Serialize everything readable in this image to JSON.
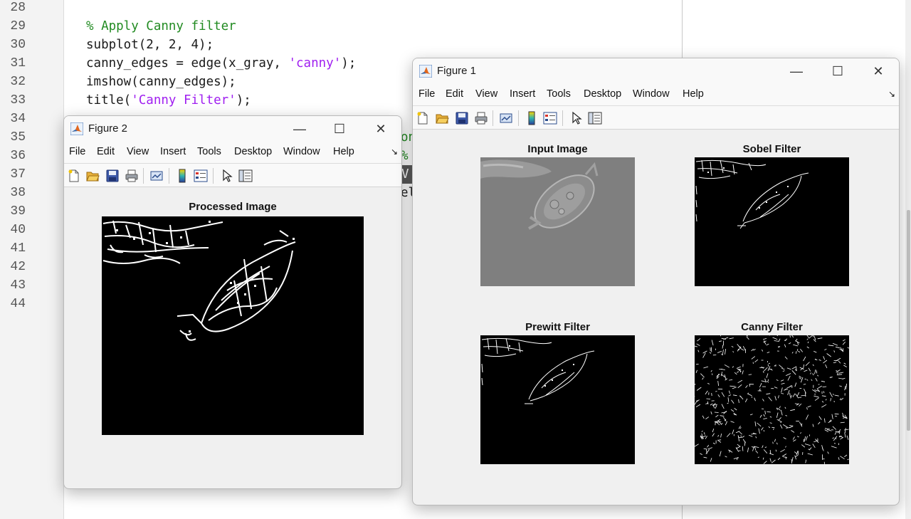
{
  "editor": {
    "line_numbers": [
      "28",
      "29",
      "30",
      "31",
      "32",
      "33",
      "34",
      "35",
      "36",
      "37",
      "38",
      "39",
      "40",
      "41",
      "42",
      "43",
      "44"
    ],
    "code": {
      "l29": "% Apply Canny filter",
      "l30": "subplot(2, 2, 4);",
      "l31a": "canny_edges = edge(x_gray, ",
      "l31b": "'canny'",
      "l31c": ");",
      "l32": "imshow(canny_edges);",
      "l33a": "title(",
      "l33b": "'Canny Filter'",
      "l33c": ");"
    },
    "peek": {
      "l35": "on",
      "l36": "%",
      "l37": "V",
      "l38": "el"
    },
    "colors": {
      "comment": "#228b22",
      "string": "#a020f0"
    }
  },
  "menus": [
    "File",
    "Edit",
    "View",
    "Insert",
    "Tools",
    "Desktop",
    "Window",
    "Help"
  ],
  "figure2": {
    "title": "Figure 2",
    "axes_title": "Processed Image"
  },
  "figure1": {
    "title": "Figure 1",
    "axes": [
      {
        "title": "Input Image"
      },
      {
        "title": "Sobel Filter"
      },
      {
        "title": "Prewitt Filter"
      },
      {
        "title": "Canny Filter"
      }
    ]
  },
  "icons": {
    "window": [
      "matlab-logo-icon",
      "minimize-icon",
      "maximize-icon",
      "close-icon",
      "menu-dock-arrow-icon"
    ],
    "toolbar": [
      "new-figure-icon",
      "open-file-icon",
      "save-icon",
      "print-icon",
      "link-plot-icon",
      "insert-colorbar-icon",
      "insert-legend-icon",
      "edit-plot-pointer-icon",
      "property-inspector-icon"
    ]
  },
  "glyphs": {
    "minimize": "—",
    "maximize": "☐",
    "close": "✕",
    "dock_arrow": "↘"
  }
}
